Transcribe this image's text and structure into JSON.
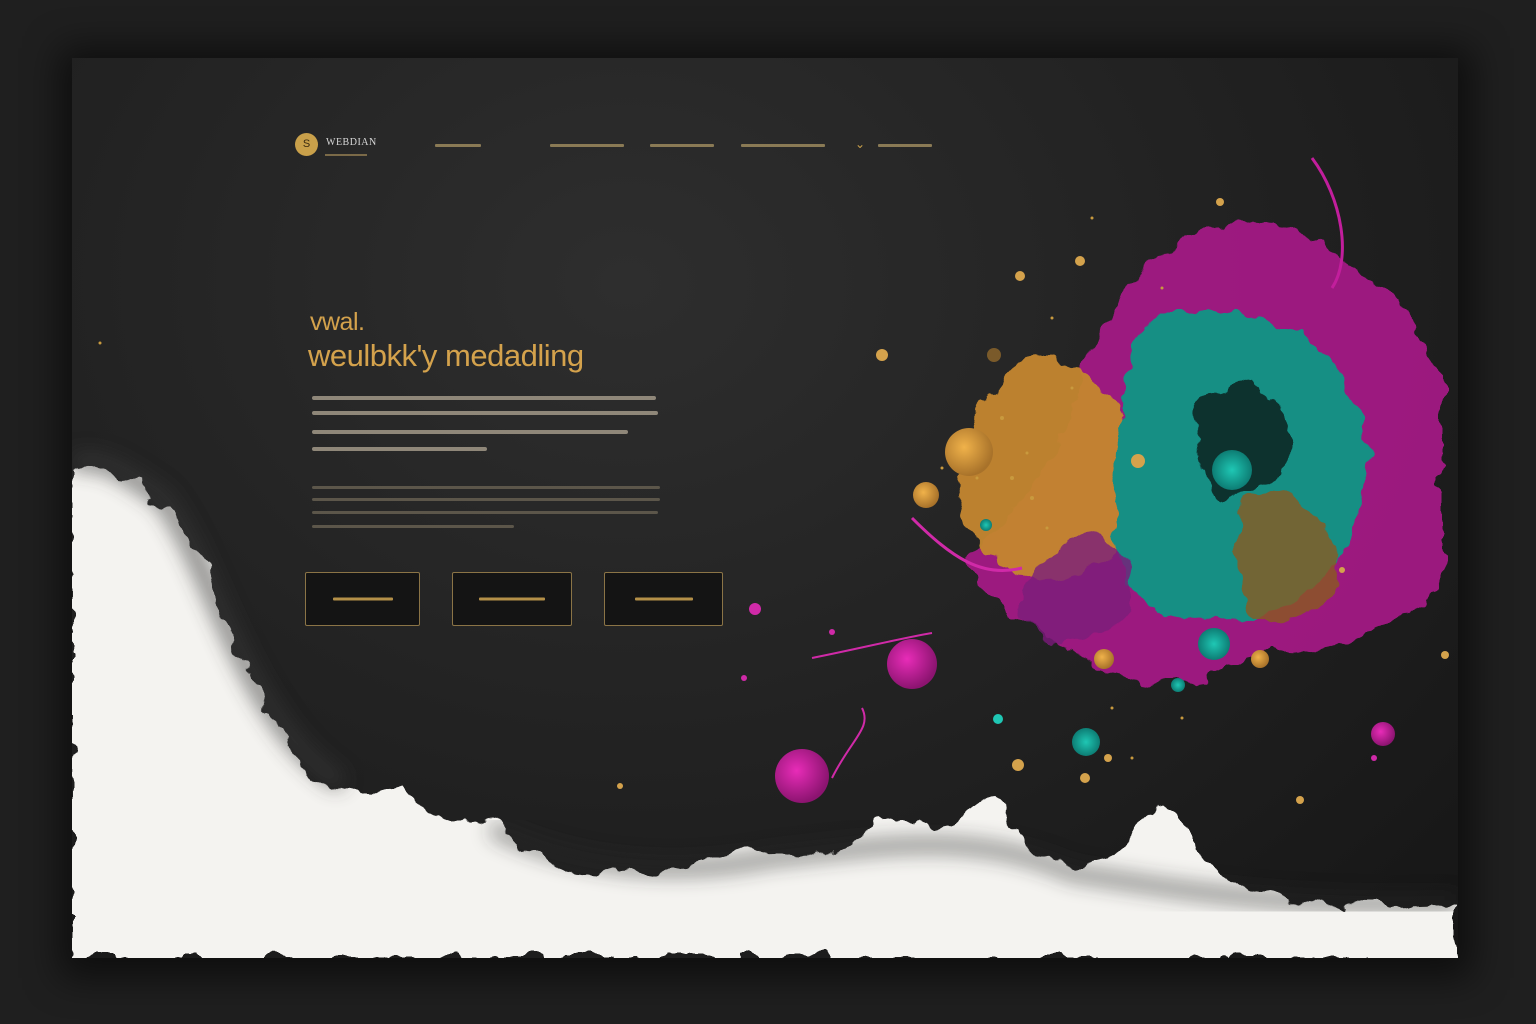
{
  "header": {
    "logo_glyph": "S",
    "brand_name": "WEBDIAN"
  },
  "hero": {
    "kicker": "vwal.",
    "title": "weulbkk'y medadling"
  },
  "colors": {
    "accent_gold": "#d4a24c",
    "accent_teal": "#17b3a3",
    "accent_magenta": "#c21e9c",
    "background": "#232323",
    "paint_white": "#f4f3f0"
  },
  "icons": [
    "chevron-down-icon"
  ]
}
